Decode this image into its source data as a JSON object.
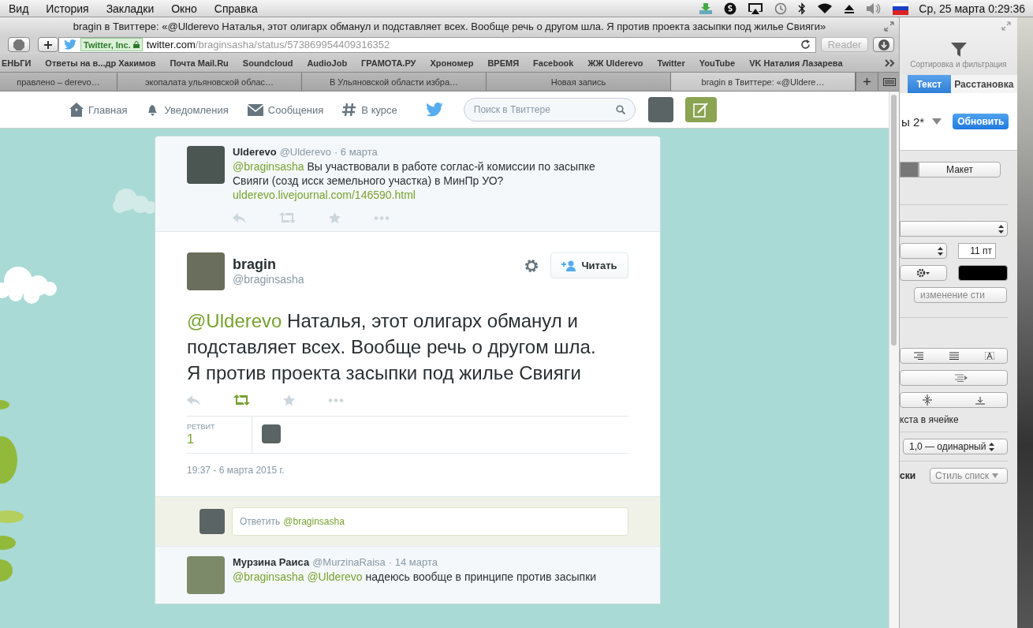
{
  "menubar": {
    "items": [
      "Вид",
      "История",
      "Закладки",
      "Окно",
      "Справка"
    ],
    "clock": "Ср, 25 марта  0:29:36"
  },
  "browser": {
    "title": "bragin в Твиттере: «@Ulderevo Наталья, этот олигарх обманул и подставляет всех. Вообще речь о другом шла. Я против проекта засыпки под жилье Свияги»",
    "url": {
      "company": "Twitter, Inc.",
      "host": "twitter.com",
      "path": "/braginsasha/status/573869954409316352"
    },
    "reader": "Reader",
    "bookmarks": [
      "ЕНЬГИ",
      "Ответы на в...др Хакимов",
      "Почта Mail.Ru",
      "Soundcloud",
      "AudioJob",
      "ГРАМОТА.РУ",
      "Хрономер",
      "ВРЕМЯ",
      "Facebook",
      "ЖЖ Ulderevo",
      "Twitter",
      "YouTube",
      "VK Наталия Лазарева"
    ],
    "tabs": [
      {
        "label": "правлено – derevo…",
        "selected": false
      },
      {
        "label": "экопалата ульяновской облас…",
        "selected": false
      },
      {
        "label": "В Ульяновской области избра…",
        "selected": false
      },
      {
        "label": "Новая запись",
        "selected": false
      },
      {
        "label": "bragin в Твиттере: «@Uldere…",
        "selected": true
      }
    ]
  },
  "twitter": {
    "nav": [
      "Главная",
      "Уведомления",
      "Сообщения",
      "В курсе"
    ],
    "search": {
      "placeholder": "Поиск в Твиттере"
    },
    "parent_tweet": {
      "name": "Ulderevo",
      "handle": "@Ulderevo",
      "date": "· 6 марта",
      "mention": "@braginsasha",
      "text": "Вы участвовали в работе соглас-й комиссии по  засыпке Свияги (созд исск земельного участка) в МинПр УО?",
      "link": "ulderevo.livejournal.com/146590.html",
      "retweeted": false
    },
    "main_tweet": {
      "name": "bragin",
      "handle": "@braginsasha",
      "follow": "Читать",
      "mention": "@Ulderevo",
      "text": "Наталья, этот олигарх обманул и подставляет всех. Вообще речь о другом шла. Я против проекта засыпки под жилье  Свияги",
      "retweeted": true,
      "stat_label": "РЕТВИТ",
      "stat_count": "1",
      "timestamp": "19:37 - 6 марта 2015 г."
    },
    "reply": {
      "placeholder": "Ответить",
      "mention": "@braginsasha"
    },
    "next_tweet": {
      "name": "Мурзина Раиса",
      "handle": "@MurzinaRaisa",
      "date": "· 14 марта",
      "mentions": "@braginsasha @Ulderevo",
      "text": "надеюсь вообще в принципе против засыпки"
    }
  },
  "inspector": {
    "filter_label": "Сортировка и фильтрация",
    "tabs": [
      {
        "label": "Текст",
        "selected": true
      },
      {
        "label": "Расстановка",
        "selected": false
      }
    ],
    "style_name": "ы 2*",
    "update": "Обновить",
    "layout": "Макет",
    "font_size": "11 пт",
    "style_change": "изменение сти",
    "cell_text": "кста в ячейке",
    "spacing": "1,0 — одинарный",
    "list_label": "ски",
    "list_style": "Стиль списк"
  }
}
